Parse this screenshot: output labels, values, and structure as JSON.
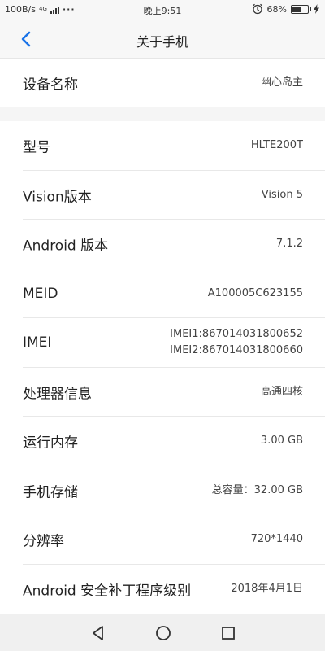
{
  "status_bar": {
    "speed": "100B/s",
    "network_type": "4G",
    "time": "晚上9:51",
    "battery_percent": "68%",
    "battery_level": 0.68
  },
  "header": {
    "title": "关于手机"
  },
  "device_name": {
    "label": "设备名称",
    "value": "幽心岛主"
  },
  "info": {
    "model": {
      "label": "型号",
      "value": "HLTE200T"
    },
    "vision": {
      "label": "Vision版本",
      "value": "Vision 5"
    },
    "android": {
      "label": "Android 版本",
      "value": "7.1.2"
    },
    "meid": {
      "label": "MEID",
      "value": "A100005C623155"
    },
    "imei": {
      "label": "IMEI",
      "value1": "IMEI1:867014031800652",
      "value2": "IMEI2:867014031800660"
    },
    "processor": {
      "label": "处理器信息",
      "value": "高通四核"
    },
    "ram": {
      "label": "运行内存",
      "value": "3.00 GB"
    },
    "storage": {
      "label": "手机存储",
      "value": "总容量：32.00 GB"
    },
    "resolution": {
      "label": "分辨率",
      "value": "720*1440"
    },
    "security_patch": {
      "label": "Android 安全补丁程序级别",
      "value": "2018年4月1日"
    }
  },
  "icons": {
    "back": "chevron-left-icon",
    "alarm": "alarm-clock-icon",
    "nav_back": "triangle-back-icon",
    "nav_home": "circle-home-icon",
    "nav_recent": "square-recent-icon"
  },
  "colors": {
    "accent": "#1a73e8",
    "background": "#f5f5f5"
  }
}
